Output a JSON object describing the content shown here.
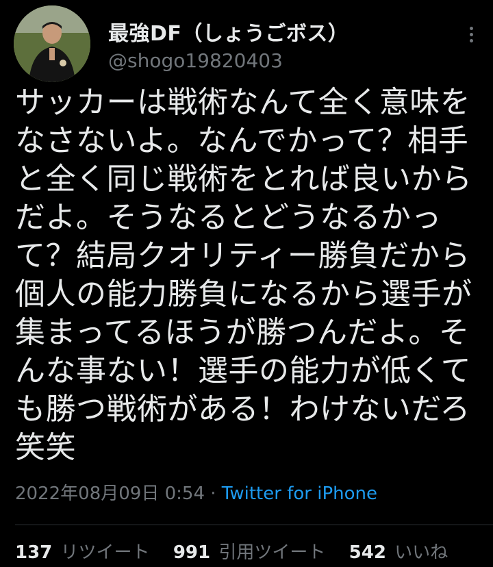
{
  "theme": {
    "background": "#000000",
    "text": "#e7e9ea",
    "secondary_text": "#71767b",
    "link": "#1d9bf0",
    "divider": "#2f3336"
  },
  "author": {
    "display_name": "最強DF（しょうごボス）",
    "handle": "@shogo19820403",
    "avatar_icon": "profile-photo"
  },
  "tweet": {
    "text": "サッカーは戦術なんて全く意味を\nなさないよ。なんでかって？相手\nと全く同じ戦術をとれば良いから\nだよ。そうなるとどうなるかっ\nて？結局クオリティー勝負だから\n個人の能力勝負になるから選手が\n集まってるほうが勝つんだよ。そ\nんな事ない！選手の能力が低くて\nも勝つ戦術がある！わけないだろ\n笑笑"
  },
  "meta": {
    "timestamp": "2022年08月09日 0:54",
    "separator": "·",
    "source": "Twitter for iPhone"
  },
  "stats": {
    "retweets_count": "137",
    "retweets_label": "リツイート",
    "quotes_count": "991",
    "quotes_label": "引用ツイート",
    "likes_count": "542",
    "likes_label": "いいね"
  },
  "icons": {
    "more": "more-vertical-icon"
  }
}
